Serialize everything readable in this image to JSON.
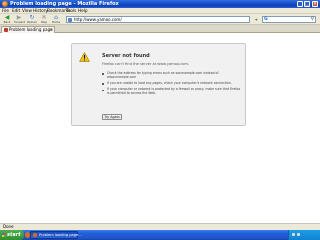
{
  "window": {
    "title": "Problem loading page - Mozilla Firefox"
  },
  "menu": [
    "File",
    "Edit",
    "View",
    "History",
    "Bookmarks",
    "Tools",
    "Help"
  ],
  "toolbar": {
    "buttons": [
      {
        "label": "Back",
        "icon": "back-arrow-icon"
      },
      {
        "label": "Forward",
        "icon": "forward-arrow-icon"
      },
      {
        "label": "Reload",
        "icon": "reload-icon"
      },
      {
        "label": "Stop",
        "icon": "stop-icon"
      },
      {
        "label": "Home",
        "icon": "home-icon"
      }
    ],
    "address": "http://www.yamoo.com/",
    "go_icon": "go-arrow-icon",
    "search_engine_icon": "google-icon"
  },
  "tabs": [
    {
      "label": "Problem loading page",
      "active": true
    }
  ],
  "error_page": {
    "title": "Server not found",
    "short_desc": "Firefox can't find the server at www.yamoo.com.",
    "suggestions": [
      "Check the address for typing errors such as ww.example.com instead of www.example.com",
      "If you are unable to load any pages, check your computer's network connection.",
      "If your computer or network is protected by a firewall or proxy, make sure that Firefox is permitted to access the Web."
    ],
    "try_again": "Try Again",
    "icon": "warning-icon",
    "icon_color": "#f5c400"
  },
  "status": {
    "text": "Done"
  },
  "taskbar": {
    "start_label": "start",
    "window_button": "Problem loading page...",
    "clock": "",
    "accent": "#245edb"
  }
}
